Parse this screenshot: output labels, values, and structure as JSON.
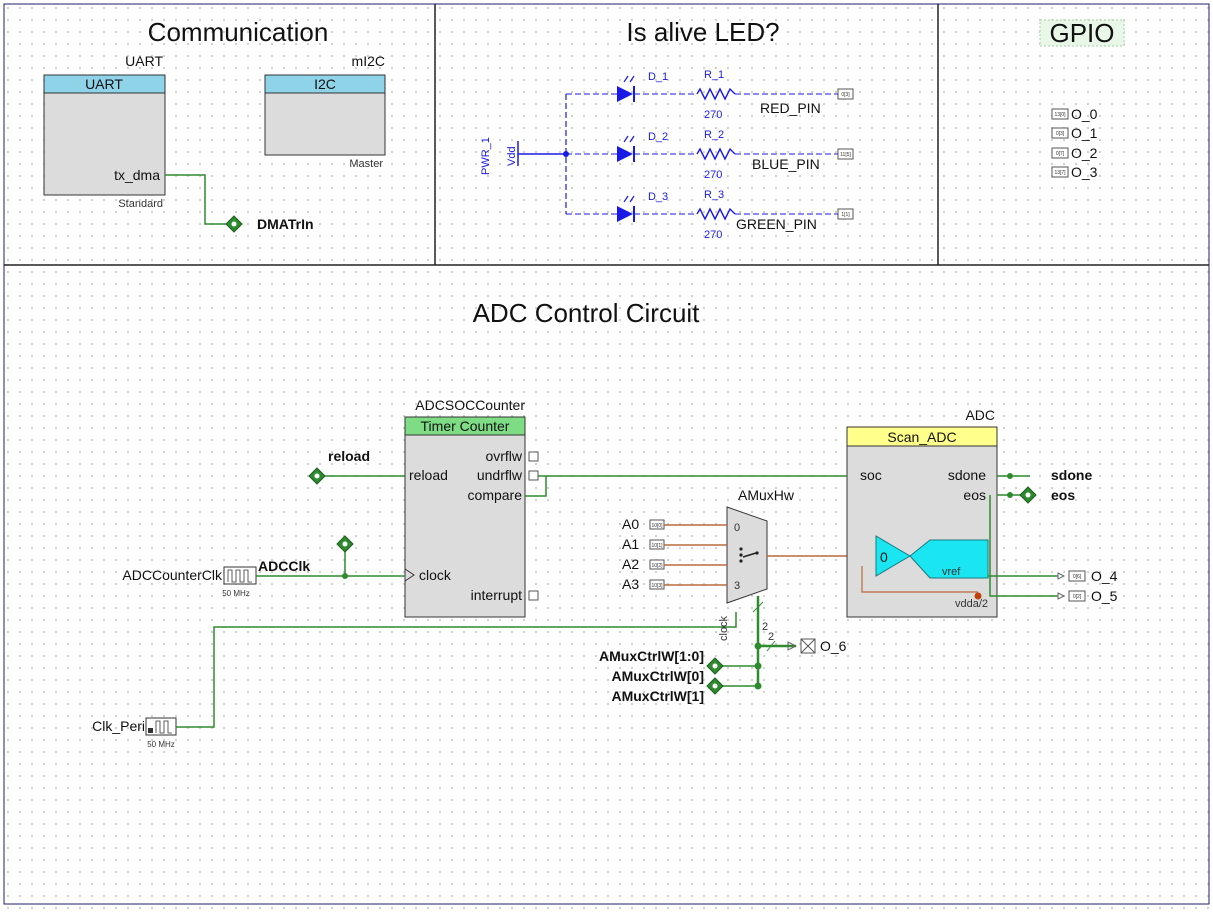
{
  "sections": {
    "communication": {
      "title": "Communication",
      "uart": {
        "instance": "UART",
        "header": "UART",
        "port": "tx_dma",
        "mode": "Standard",
        "net": "DMATrIn"
      },
      "i2c": {
        "instance": "mI2C",
        "header": "I2C",
        "mode": "Master"
      }
    },
    "led": {
      "title": "Is alive LED?",
      "power": {
        "name": "PWR_1",
        "net": "Vdd"
      },
      "channels": [
        {
          "diode": "D_1",
          "resistor": "R_1",
          "value": "270",
          "pin": "RED_PIN",
          "pin_no": "0[3]"
        },
        {
          "diode": "D_2",
          "resistor": "R_2",
          "value": "270",
          "pin": "BLUE_PIN",
          "pin_no": "11[5]"
        },
        {
          "diode": "D_3",
          "resistor": "R_3",
          "value": "270",
          "pin": "GREEN_PIN",
          "pin_no": "1[1]"
        }
      ]
    },
    "gpio": {
      "title": "GPIO",
      "pins": [
        {
          "name": "O_0",
          "pin_no": "13[0]"
        },
        {
          "name": "O_1",
          "pin_no": "0[3]"
        },
        {
          "name": "O_2",
          "pin_no": "0[7]"
        },
        {
          "name": "O_3",
          "pin_no": "13[7]"
        }
      ]
    },
    "adc": {
      "title": "ADC Control Circuit",
      "counter": {
        "instance": "ADCSOCCounter",
        "header": "Timer Counter",
        "ports": {
          "reload": "reload",
          "clock": "clock",
          "ovrflw": "ovrflw",
          "undrflw": "undrflw",
          "compare": "compare",
          "interrupt": "interrupt"
        }
      },
      "reload_net": "reload",
      "adc_clk": {
        "name": "ADCCounterClk",
        "freq": "50 MHz",
        "net": "ADCClk"
      },
      "peri_clk": {
        "name": "Clk_Peri",
        "freq": "50 MHz"
      },
      "amux": {
        "instance": "AMuxHw",
        "clock_port": "clock",
        "inputs": [
          {
            "name": "A0",
            "index": "0",
            "pin_no": "10[0]"
          },
          {
            "name": "A1",
            "index": "1",
            "pin_no": "10[1]"
          },
          {
            "name": "A2",
            "index": "2",
            "pin_no": "10[2]"
          },
          {
            "name": "A3",
            "index": "3",
            "pin_no": "10[3]"
          }
        ],
        "bus_width": "2",
        "bus_width_2": "2"
      },
      "scan_adc": {
        "instance": "ADC",
        "header": "Scan_ADC",
        "soc": "soc",
        "sdone": "sdone",
        "eos": "eos",
        "comparator_label": "0",
        "vref": "vref",
        "vdda": "vdda/2"
      },
      "outputs": {
        "sdone": "sdone",
        "eos": "eos",
        "o4": {
          "name": "O_4",
          "pin_no": "0[6]"
        },
        "o5": {
          "name": "O_5",
          "pin_no": "0[2]"
        },
        "o6": {
          "name": "O_6"
        }
      },
      "ctrl_nets": [
        "AMuxCtrlW[1:0]",
        "AMuxCtrlW[0]",
        "AMuxCtrlW[1]"
      ]
    }
  },
  "colors": {
    "wire": "#2e8b2e",
    "analog": "#b86a3c",
    "led": "#1a1ae6",
    "header_blue": "#8fd3e8",
    "header_green": "#7ddc84",
    "header_yellow": "#ffff8c",
    "cyan": "#19e6f0",
    "body_gray": "#dcdcdc"
  }
}
